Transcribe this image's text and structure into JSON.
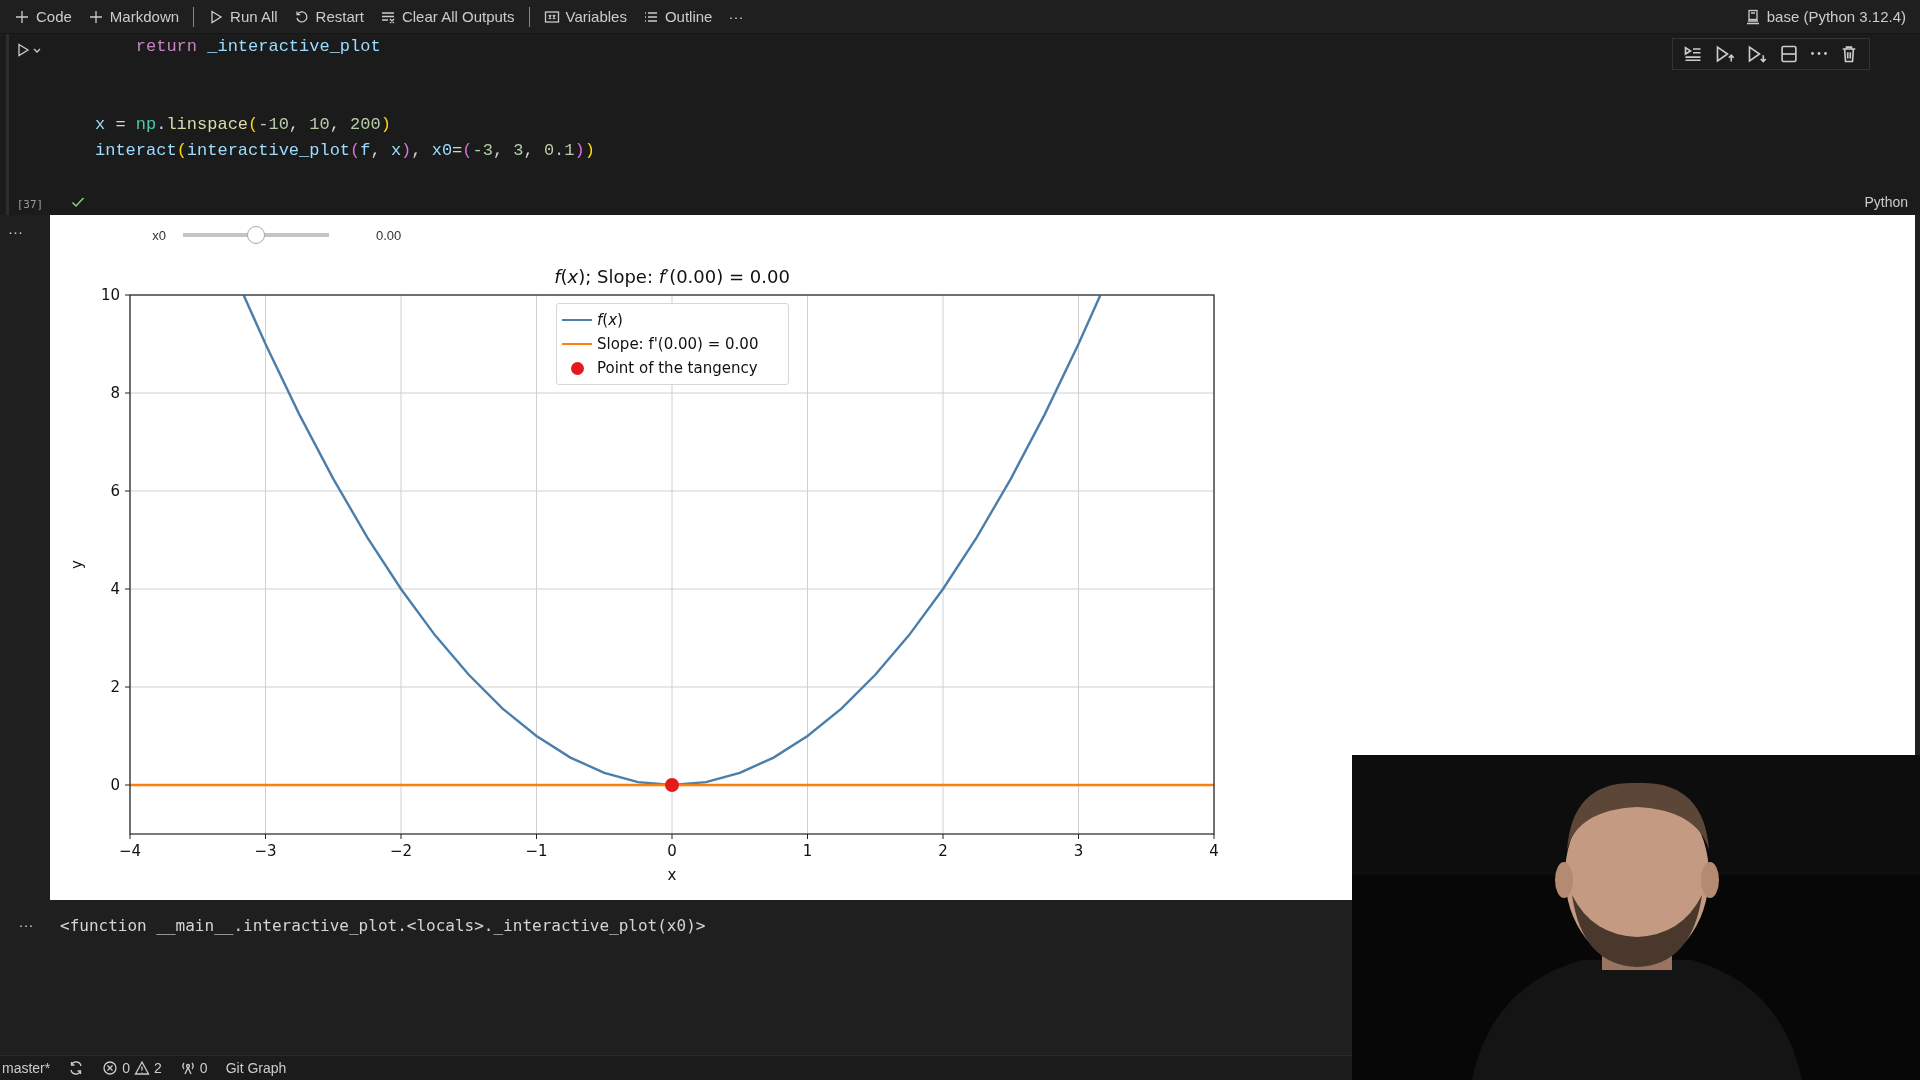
{
  "toolbar": {
    "items": [
      {
        "kind": "add",
        "label": "Code"
      },
      {
        "kind": "add",
        "label": "Markdown"
      },
      {
        "kind": "separator"
      },
      {
        "kind": "run",
        "label": "Run All"
      },
      {
        "kind": "restart",
        "label": "Restart"
      },
      {
        "kind": "clear",
        "label": "Clear All Outputs"
      },
      {
        "kind": "separator"
      },
      {
        "kind": "variables",
        "label": "Variables"
      },
      {
        "kind": "outline",
        "label": "Outline"
      },
      {
        "kind": "more",
        "label": "···"
      }
    ],
    "kernel": "base (Python 3.12.4)"
  },
  "code_cell": {
    "lines": [
      {
        "kind": "code",
        "tokens": [
          {
            "text": "    return",
            "kind": "keyword"
          },
          {
            "text": " _interactive_plot",
            "kind": "var"
          }
        ]
      },
      {
        "kind": "blank"
      },
      {
        "kind": "blank"
      },
      {
        "kind": "code",
        "tokens": [
          {
            "text": "x",
            "kind": "var"
          },
          {
            "text": " = ",
            "kind": "plain"
          },
          {
            "text": "np",
            "kind": "module"
          },
          {
            "text": ".",
            "kind": "plain"
          },
          {
            "text": "linspace",
            "kind": "func"
          },
          {
            "text": "(",
            "kind": "bracket1"
          },
          {
            "text": "-10",
            "kind": "number"
          },
          {
            "text": ", ",
            "kind": "plain"
          },
          {
            "text": "10",
            "kind": "number"
          },
          {
            "text": ", ",
            "kind": "plain"
          },
          {
            "text": "200",
            "kind": "number"
          },
          {
            "text": ")",
            "kind": "bracket1"
          }
        ]
      },
      {
        "kind": "code",
        "tokens": [
          {
            "text": "interact",
            "kind": "var"
          },
          {
            "text": "(",
            "kind": "bracket1"
          },
          {
            "text": "interactive_plot",
            "kind": "var"
          },
          {
            "text": "(",
            "kind": "bracket2"
          },
          {
            "text": "f",
            "kind": "var"
          },
          {
            "text": ", ",
            "kind": "plain"
          },
          {
            "text": "x",
            "kind": "var"
          },
          {
            "text": ")",
            "kind": "bracket2"
          },
          {
            "text": ", ",
            "kind": "plain"
          },
          {
            "text": "x0",
            "kind": "var"
          },
          {
            "text": "=",
            "kind": "plain"
          },
          {
            "text": "(",
            "kind": "bracket2"
          },
          {
            "text": "-3",
            "kind": "number"
          },
          {
            "text": ", ",
            "kind": "plain"
          },
          {
            "text": "3",
            "kind": "number"
          },
          {
            "text": ", ",
            "kind": "plain"
          },
          {
            "text": "0.1",
            "kind": "number"
          },
          {
            "text": ")",
            "kind": "bracket2"
          },
          {
            "text": ")",
            "kind": "bracket1"
          }
        ]
      }
    ],
    "execution_count": "[37]",
    "succeeded": true,
    "language": "Python"
  },
  "output": {
    "menu": "···",
    "slider": {
      "label": "x0",
      "level": 0.5,
      "reading": "0.00"
    },
    "chart_data": {
      "type": "line",
      "title": "*f*(*x*); Slope: *f*′(0.00) = 0.00",
      "xlabel": "x",
      "ylabel": "y",
      "x": [
        -4,
        -3.16,
        -3,
        -2.75,
        -2.5,
        -2.25,
        -2,
        -1.75,
        -1.5,
        -1.25,
        -1,
        -0.75,
        -0.5,
        -0.25,
        0,
        0.25,
        0.5,
        0.75,
        1,
        1.25,
        1.5,
        1.75,
        2,
        2.25,
        2.5,
        2.75,
        3,
        3.16,
        4
      ],
      "series": [
        {
          "name": "*f*(*x*)",
          "color": "#4a7eab",
          "values": [
            null,
            9.99,
            9,
            7.56,
            6.25,
            5.06,
            4,
            3.06,
            2.25,
            1.56,
            1,
            0.56,
            0.25,
            0.06,
            0,
            0.06,
            0.25,
            0.56,
            1,
            1.56,
            2.25,
            3.06,
            4,
            5.06,
            6.25,
            7.56,
            9,
            9.99,
            null
          ]
        },
        {
          "name": "Slope: f'(0.00) = 0.00",
          "color": "#ff7f0e",
          "values": [
            0,
            0,
            0,
            0,
            0,
            0,
            0,
            0,
            0,
            0,
            0,
            0,
            0,
            0,
            0,
            0,
            0,
            0,
            0,
            0,
            0,
            0,
            0,
            0,
            0,
            0,
            0,
            0,
            0
          ]
        },
        {
          "name": "Point of the tangency",
          "color": "#e41a1c",
          "marker": "o",
          "values": [
            null,
            null,
            null,
            null,
            null,
            null,
            null,
            null,
            null,
            null,
            null,
            null,
            null,
            null,
            0,
            null,
            null,
            null,
            null,
            null,
            null,
            null,
            null,
            null,
            null,
            null,
            null,
            null,
            null
          ]
        }
      ],
      "xlim": [
        -4,
        4
      ],
      "ylim": [
        -1,
        10
      ],
      "xticks": [
        {
          "value": -4,
          "label": "−4"
        },
        {
          "value": -3,
          "label": "−3"
        },
        {
          "value": -2,
          "label": "−2"
        },
        {
          "value": -1,
          "label": "−1"
        },
        0,
        1,
        2,
        3,
        4
      ],
      "yticks": [
        0,
        2,
        4,
        6,
        8,
        10
      ],
      "grid": true,
      "legend": "upper center"
    }
  },
  "text_output": {
    "menu": "···",
    "text": "<function __main__.interactive_plot.<locals>._interactive_plot(x0)>"
  },
  "status_bar": {
    "items": [
      {
        "kind": "branch",
        "label": "master*"
      },
      {
        "kind": "sync"
      },
      {
        "kind": "problems",
        "errors": "0",
        "warnings": "2"
      },
      {
        "kind": "ports",
        "label": "0"
      },
      {
        "kind": "text",
        "label": "Git Graph"
      }
    ]
  }
}
